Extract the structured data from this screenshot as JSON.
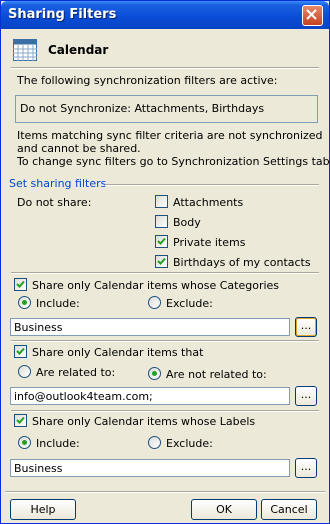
{
  "window": {
    "title": "Sharing Filters"
  },
  "header": {
    "label": "Calendar",
    "icon": "calendar-icon"
  },
  "intro": {
    "active_text": "The following synchronization filters are active:",
    "active_value": "Do not Synchronize: Attachments, Birthdays",
    "note_line1": "Items matching sync filter criteria are not synchronized",
    "note_line2": "and cannot be shared.",
    "note_line3": "To change sync filters go to Synchronization Settings tab."
  },
  "sharing": {
    "group_title": "Set sharing filters",
    "do_not_share_label": "Do not share:",
    "options": [
      {
        "label": "Attachments",
        "checked": false
      },
      {
        "label": "Body",
        "checked": false
      },
      {
        "label": "Private items",
        "checked": true
      },
      {
        "label": "Birthdays of my contacts",
        "checked": true
      }
    ]
  },
  "categories": {
    "checkbox_label": "Share only Calendar items whose Categories",
    "checked": true,
    "include_label": "Include:",
    "exclude_label": "Exclude:",
    "selected": "include",
    "value": "Business"
  },
  "related": {
    "checkbox_label": "Share only Calendar items that",
    "checked": true,
    "related_label": "Are related to:",
    "not_related_label": "Are not related to:",
    "selected": "not_related",
    "value": "info@outlook4team.com;"
  },
  "labels": {
    "checkbox_label": "Share only Calendar items whose Labels",
    "checked": true,
    "include_label": "Include:",
    "exclude_label": "Exclude:",
    "selected": "include",
    "value": "Business"
  },
  "buttons": {
    "help": "Help",
    "ok": "OK",
    "cancel": "Cancel",
    "browse": "..."
  }
}
